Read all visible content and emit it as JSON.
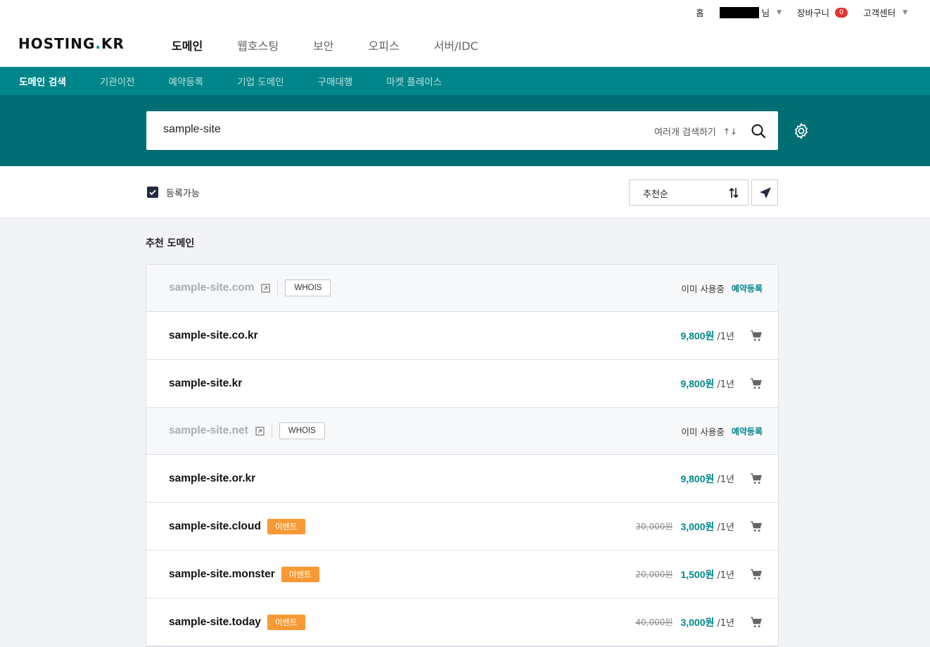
{
  "util": {
    "home": "홈",
    "user_suffix": "님",
    "cart_label": "장바구니",
    "cart_count": "0",
    "support": "고객센터"
  },
  "header": {
    "logo_main": "HOSTING",
    "logo_dot": ".",
    "logo_end": "KR",
    "gnb": [
      {
        "label": "도메인",
        "active": true
      },
      {
        "label": "웹호스팅",
        "active": false
      },
      {
        "label": "보안",
        "active": false
      },
      {
        "label": "오피스",
        "active": false
      },
      {
        "label": "서버/IDC",
        "active": false
      }
    ]
  },
  "subnav": [
    {
      "label": "도메인 검색",
      "active": true
    },
    {
      "label": "기관이전",
      "active": false
    },
    {
      "label": "예약등록",
      "active": false
    },
    {
      "label": "기업 도메인",
      "active": false
    },
    {
      "label": "구매대행",
      "active": false
    },
    {
      "label": "마켓 플레이스",
      "active": false
    }
  ],
  "search": {
    "value": "sample-site",
    "multi_label": "여러개 검색하기",
    "multi_icon": "↑↓"
  },
  "filter": {
    "available_label": "등록가능",
    "sort_label": "추천순"
  },
  "list": {
    "title": "추천 도메인",
    "in_use_label": "이미 사용중",
    "reserve_label": "예약등록",
    "whois_label": "WHOIS",
    "event_label": "이벤트",
    "rows": [
      {
        "domain": "sample-site.com",
        "taken": true
      },
      {
        "domain": "sample-site.co.kr",
        "price": "9,800원",
        "term": "/1년"
      },
      {
        "domain": "sample-site.kr",
        "price": "9,800원",
        "term": "/1년"
      },
      {
        "domain": "sample-site.net",
        "taken": true
      },
      {
        "domain": "sample-site.or.kr",
        "price": "9,800원",
        "term": "/1년"
      },
      {
        "domain": "sample-site.cloud",
        "event": true,
        "old_price": "30,000원",
        "price": "3,000원",
        "term": "/1년"
      },
      {
        "domain": "sample-site.monster",
        "event": true,
        "old_price": "20,000원",
        "price": "1,500원",
        "term": "/1년"
      },
      {
        "domain": "sample-site.today",
        "event": true,
        "old_price": "40,000원",
        "price": "3,000원",
        "term": "/1년"
      }
    ]
  },
  "colors": {
    "brand": "#00868a",
    "brand_dark": "#006e72",
    "event": "#f79a34",
    "badge": "#e5322d"
  }
}
